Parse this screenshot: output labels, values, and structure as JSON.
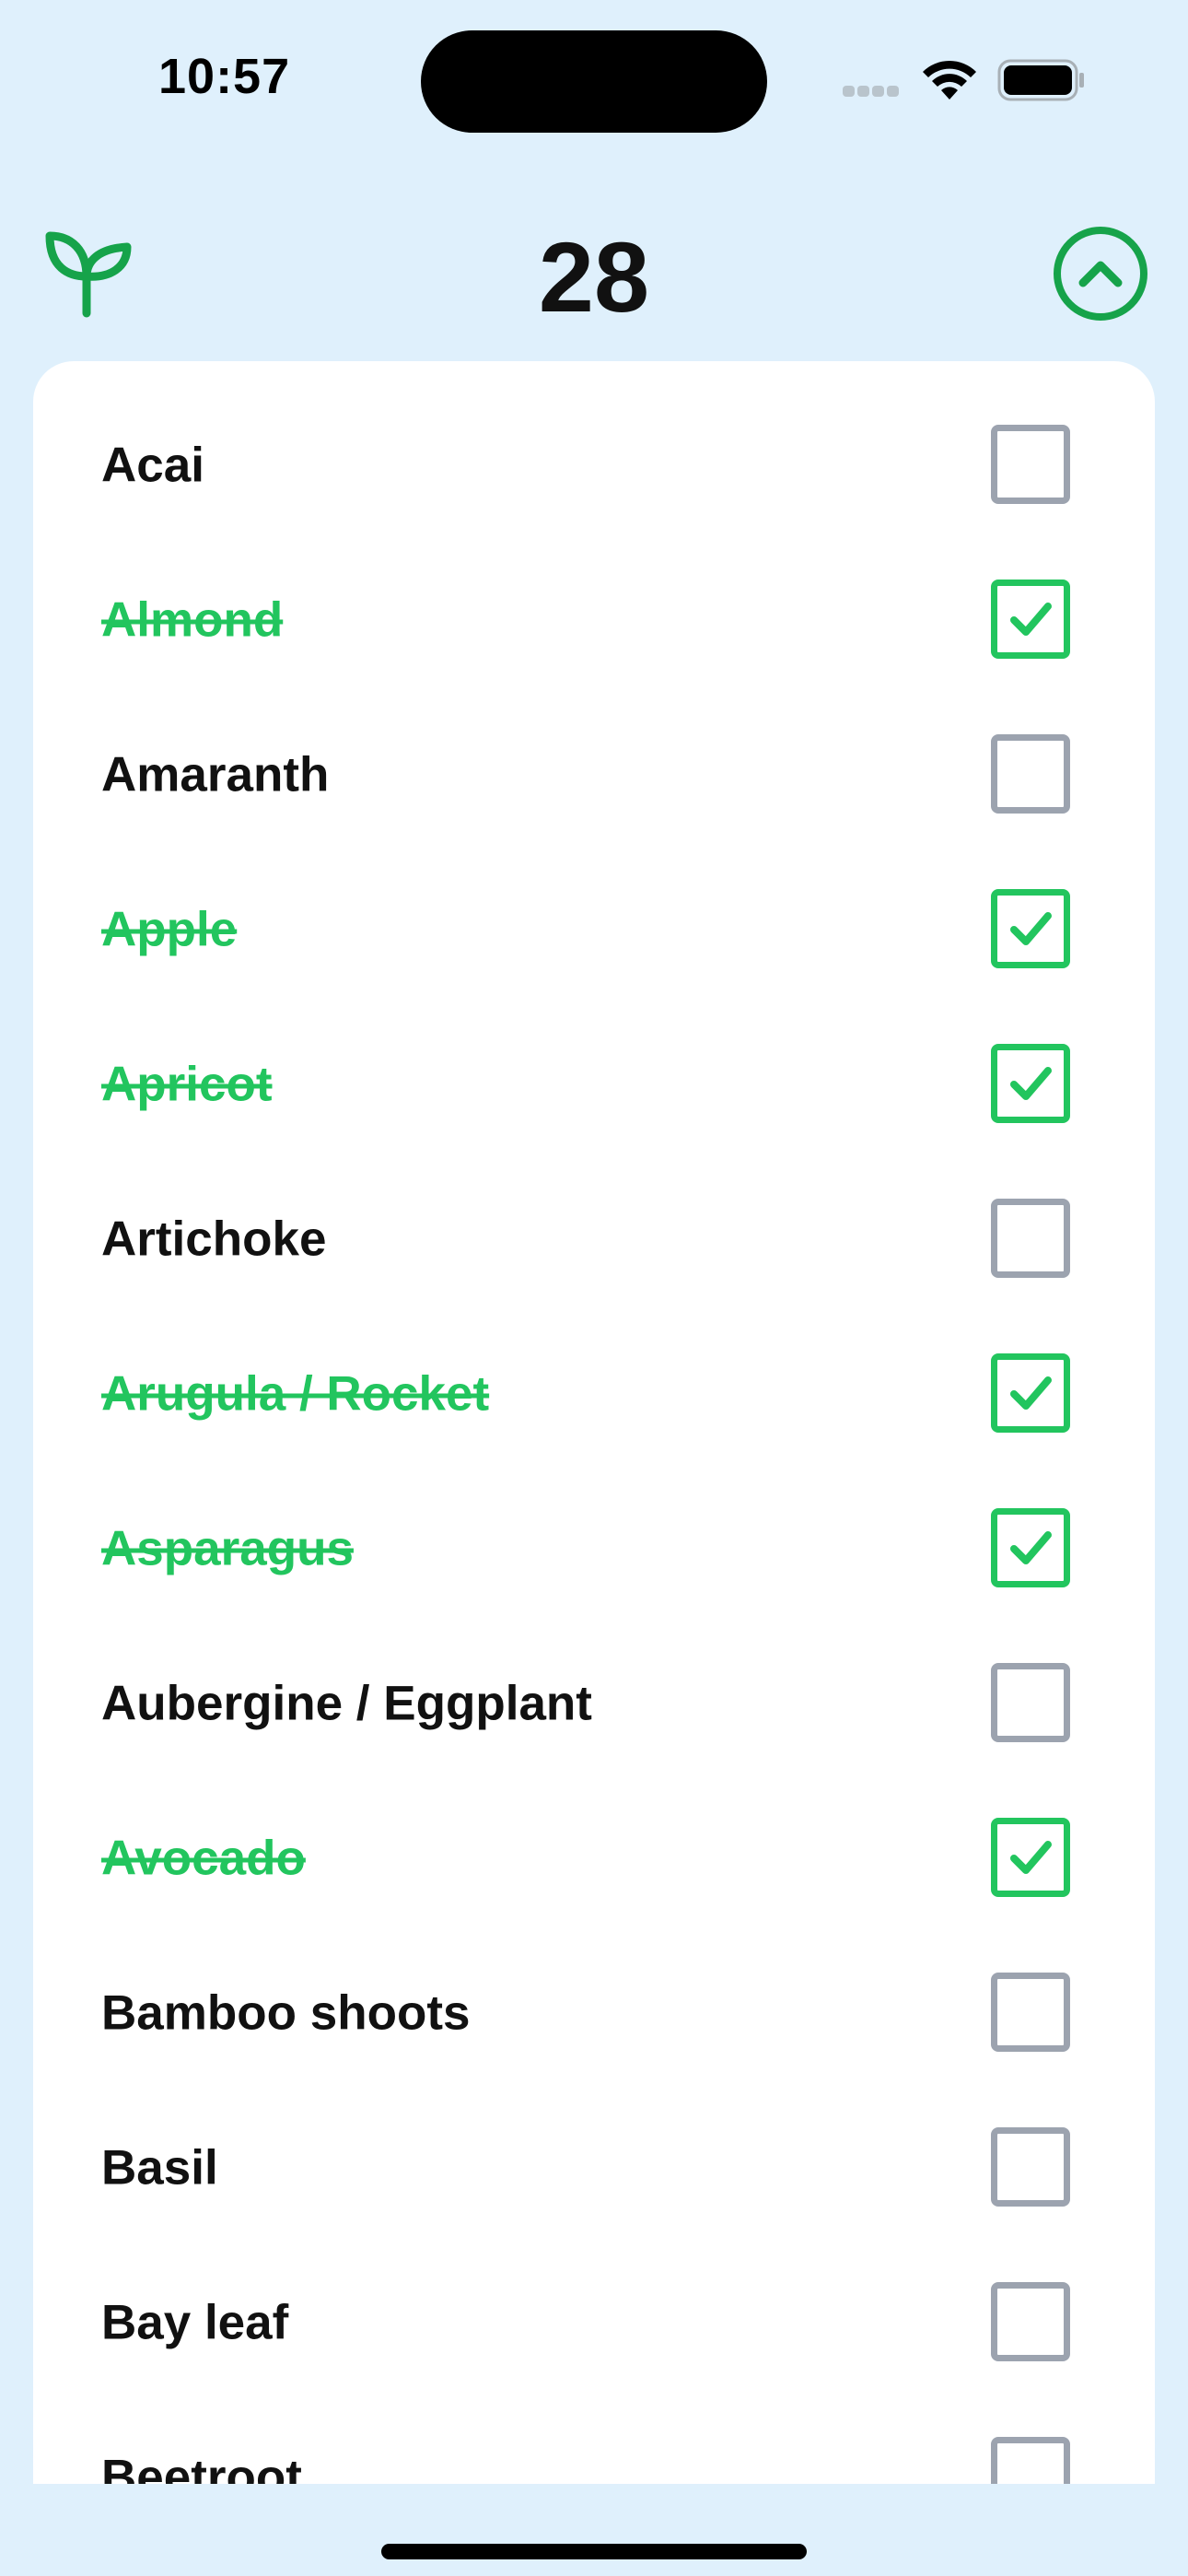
{
  "status_bar": {
    "time": "10:57"
  },
  "header": {
    "count": "28"
  },
  "items": [
    {
      "label": "Acai",
      "checked": false
    },
    {
      "label": "Almond",
      "checked": true
    },
    {
      "label": "Amaranth",
      "checked": false
    },
    {
      "label": "Apple",
      "checked": true
    },
    {
      "label": "Apricot",
      "checked": true
    },
    {
      "label": "Artichoke",
      "checked": false
    },
    {
      "label": "Arugula / Rocket",
      "checked": true
    },
    {
      "label": "Asparagus",
      "checked": true
    },
    {
      "label": "Aubergine / Eggplant",
      "checked": false
    },
    {
      "label": "Avocado",
      "checked": true
    },
    {
      "label": "Bamboo shoots",
      "checked": false
    },
    {
      "label": "Basil",
      "checked": false
    },
    {
      "label": "Bay leaf",
      "checked": false
    },
    {
      "label": "Beetroot",
      "checked": false
    }
  ],
  "colors": {
    "accent": "#22c55e",
    "icon_green": "#16a34a",
    "unchecked": "#9ca3af",
    "background": "#dff0fc"
  }
}
